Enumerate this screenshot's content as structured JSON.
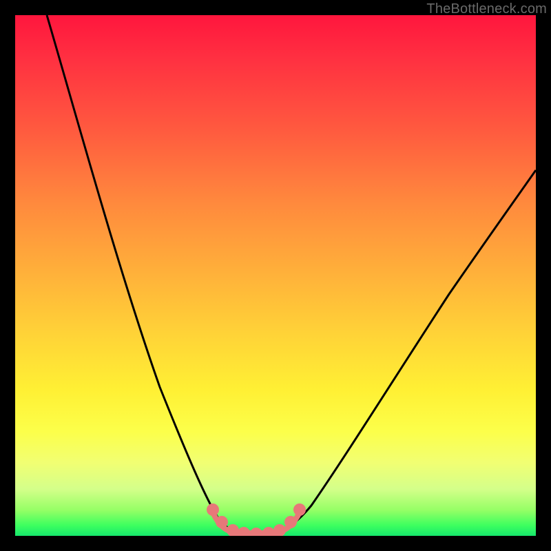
{
  "watermark": "TheBottleneck.com",
  "colors": {
    "frame": "#000000",
    "curve_stroke": "#000000",
    "marker_fill": "#e77879",
    "marker_stroke": "#e77879"
  },
  "chart_data": {
    "type": "line",
    "title": "",
    "xlabel": "",
    "ylabel": "",
    "xlim": [
      0,
      100
    ],
    "ylim": [
      0,
      100
    ],
    "grid": false,
    "legend": false,
    "note": "V-shaped bottleneck curve with a flat minimum. X is normalized hardware-balance position; Y is bottleneck percentage. Values estimated from pixel positions; no axis ticks are rendered in the image.",
    "series": [
      {
        "name": "bottleneck_curve",
        "x": [
          6,
          10,
          14,
          18,
          22,
          26,
          30,
          33,
          36,
          38,
          40,
          42,
          44,
          46,
          50,
          54,
          58,
          62,
          66,
          70,
          74,
          78,
          82,
          86,
          90,
          94,
          98
        ],
        "values": [
          100,
          90,
          79,
          68,
          57,
          46,
          35,
          25,
          16,
          9,
          4,
          1,
          0,
          0,
          1,
          4,
          10,
          17,
          24,
          31,
          38,
          45,
          52,
          58,
          64,
          69,
          73
        ]
      }
    ],
    "trough_marker": {
      "description": "Flat minimum region highlighted by dotted pink markers",
      "x_range": [
        38,
        50
      ],
      "y": 0
    }
  }
}
